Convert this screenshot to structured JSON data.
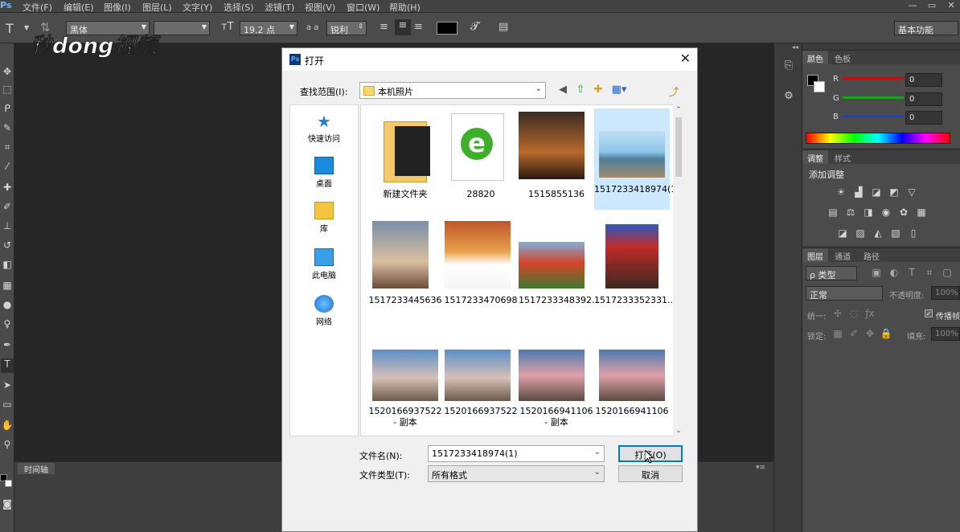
{
  "app": {
    "logo": "Ps",
    "menu": [
      "文件(F)",
      "编辑(E)",
      "图像(I)",
      "图层(L)",
      "文字(Y)",
      "选择(S)",
      "滤镜(T)",
      "视图(V)",
      "窗口(W)",
      "帮助(H)"
    ],
    "window_buttons": [
      "—",
      "▭",
      "✕"
    ]
  },
  "options_bar": {
    "tool_icon": "T",
    "font_family": "黑体",
    "font_style": "",
    "font_size": "19.2 点",
    "aa_label": "a a",
    "antialias": "锐利",
    "workspace": "基本功能",
    "color_swatch": "#000000"
  },
  "watermark": {
    "text": "秒dong视频"
  },
  "timeline": {
    "label": "时间轴"
  },
  "panels": {
    "color": {
      "tabs": [
        "颜色",
        "色板"
      ],
      "channels": [
        {
          "label": "R",
          "value": "0",
          "color": "#e02020"
        },
        {
          "label": "G",
          "value": "0",
          "color": "#20c020"
        },
        {
          "label": "B",
          "value": "0",
          "color": "#2050e0"
        }
      ]
    },
    "adjustments": {
      "tabs": [
        "调整",
        "样式"
      ],
      "title": "添加调整"
    },
    "layers": {
      "tabs": [
        "图层",
        "通道",
        "路径"
      ],
      "filter": "ρ 类型",
      "blend_mode": "正常",
      "opacity_label": "不透明度:",
      "opacity_value": "100%",
      "unify_label": "统一:",
      "propagate_label": "传播帧",
      "lock_label": "锁定:",
      "fill_label": "填充:",
      "fill_value": "100%"
    }
  },
  "dialog": {
    "title": "打开",
    "look_in_label": "查找范围(I):",
    "look_in_value": "本机照片",
    "places": [
      "快速访问",
      "桌面",
      "库",
      "此电脑",
      "网络"
    ],
    "files": [
      {
        "name": "新建文件夹"
      },
      {
        "name": "28820"
      },
      {
        "name": "1515855136"
      },
      {
        "name": "1517233418974(1)",
        "selected": true
      },
      {
        "name": "1517233445636"
      },
      {
        "name": "1517233470698"
      },
      {
        "name": "1517233348392..."
      },
      {
        "name": "1517233352331..."
      },
      {
        "name": "1520166937522 - 副本"
      },
      {
        "name": "1520166937522"
      },
      {
        "name": "1520166941106 - 副本"
      },
      {
        "name": "1520166941106"
      }
    ],
    "filename_label": "文件名(N):",
    "filename_value": "1517233418974(1)",
    "filetype_label": "文件类型(T):",
    "filetype_value": "所有格式",
    "open_button": "打开(O)",
    "cancel_button": "取消"
  }
}
